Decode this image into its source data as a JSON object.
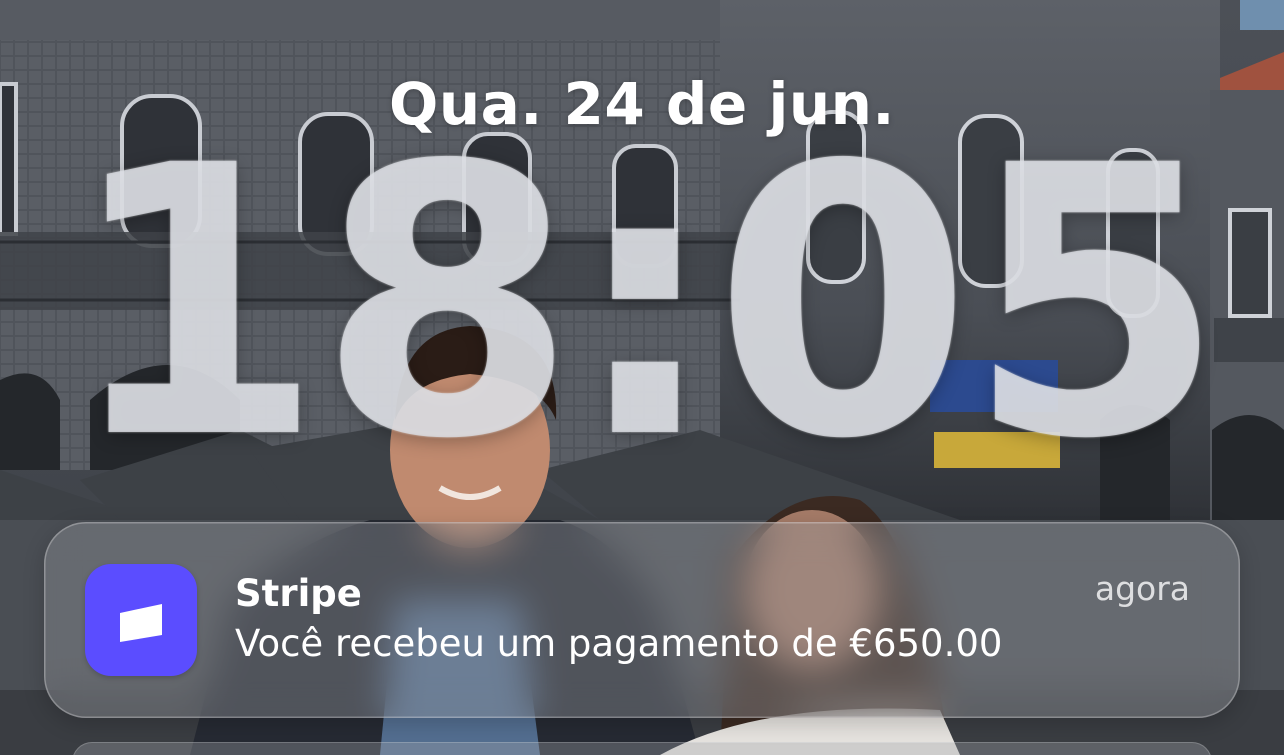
{
  "lockscreen": {
    "date": "Qua. 24 de jun.",
    "time": "18:05"
  },
  "notification": {
    "app_name": "Stripe",
    "timestamp": "agora",
    "message": "Você recebeu um pagamento de €650.00",
    "icon": "stripe-app-icon",
    "icon_color": "#5b4dff"
  },
  "wallpaper": {
    "description_icon": "photo-wallpaper"
  }
}
